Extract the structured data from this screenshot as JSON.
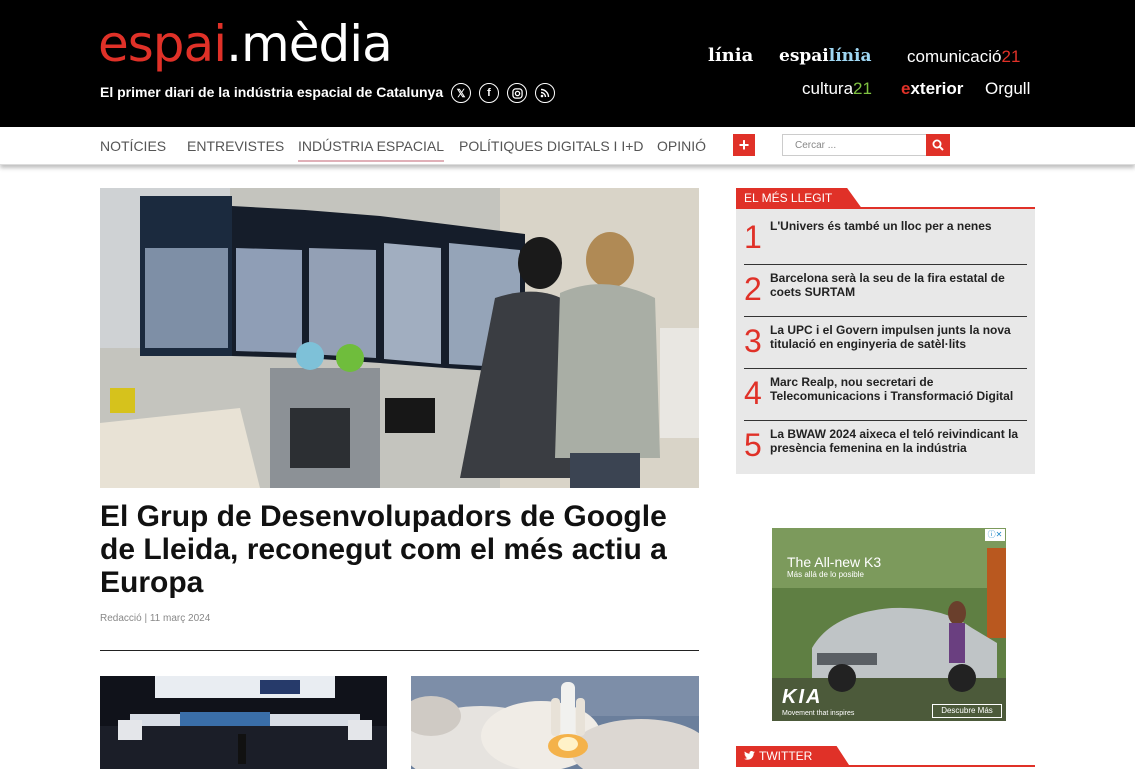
{
  "header": {
    "logo_main": "espai",
    "logo_dot": ".",
    "logo_suffix": "mèdia",
    "tagline": "El primer diari de la indústria espacial de Catalunya",
    "brands": {
      "linia": "línia",
      "espai_linia_a": "espai",
      "espai_linia_b": "línia",
      "comunicacio_a": "comunicació",
      "comunicacio_b": "21",
      "cultura_a": "cultura",
      "cultura_b": "21",
      "exterior_a": "e",
      "exterior_b": "xterior",
      "orgull": "Orgull"
    },
    "social_icons": [
      "x-icon",
      "facebook-icon",
      "instagram-icon",
      "rss-icon"
    ]
  },
  "nav": {
    "items": [
      "NOTÍCIES",
      "ENTREVISTES",
      "INDÚSTRIA ESPACIAL",
      "POLÍTIQUES DIGITALS I I+D",
      "OPINIÓ"
    ],
    "plus": "+",
    "search_placeholder": "Cercar ..."
  },
  "main": {
    "title": "El Grup de Desenvolupadors de Google de Lleida, reconegut com el més actiu a Europa",
    "meta": "Redacció | 11 març 2024"
  },
  "sidebar": {
    "most_read_title": "EL MÉS LLEGIT",
    "most_read": [
      {
        "num": "1",
        "text": "L'Univers és també un lloc per a nenes"
      },
      {
        "num": "2",
        "text": "Barcelona serà la seu de la fira estatal de coets SURTAM"
      },
      {
        "num": "3",
        "text": "La UPC i el Govern impulsen junts la nova titulació en enginyeria de satèl·lits"
      },
      {
        "num": "4",
        "text": "Marc Realp, nou secretari de Telecomunicacions i Transformació Digital"
      },
      {
        "num": "5",
        "text": "La BWAW 2024 aixeca el teló reivindicant la presència femenina en la indústria"
      }
    ],
    "ad": {
      "headline": "The All-new K3",
      "sub": "Más allá de lo posible",
      "brand": "KIA",
      "slogan": "Movement that inspires",
      "cta": "Descubre Más"
    },
    "twitter_title": "TWITTER"
  },
  "colors": {
    "accent": "#e03128",
    "header_bg": "#000000"
  }
}
